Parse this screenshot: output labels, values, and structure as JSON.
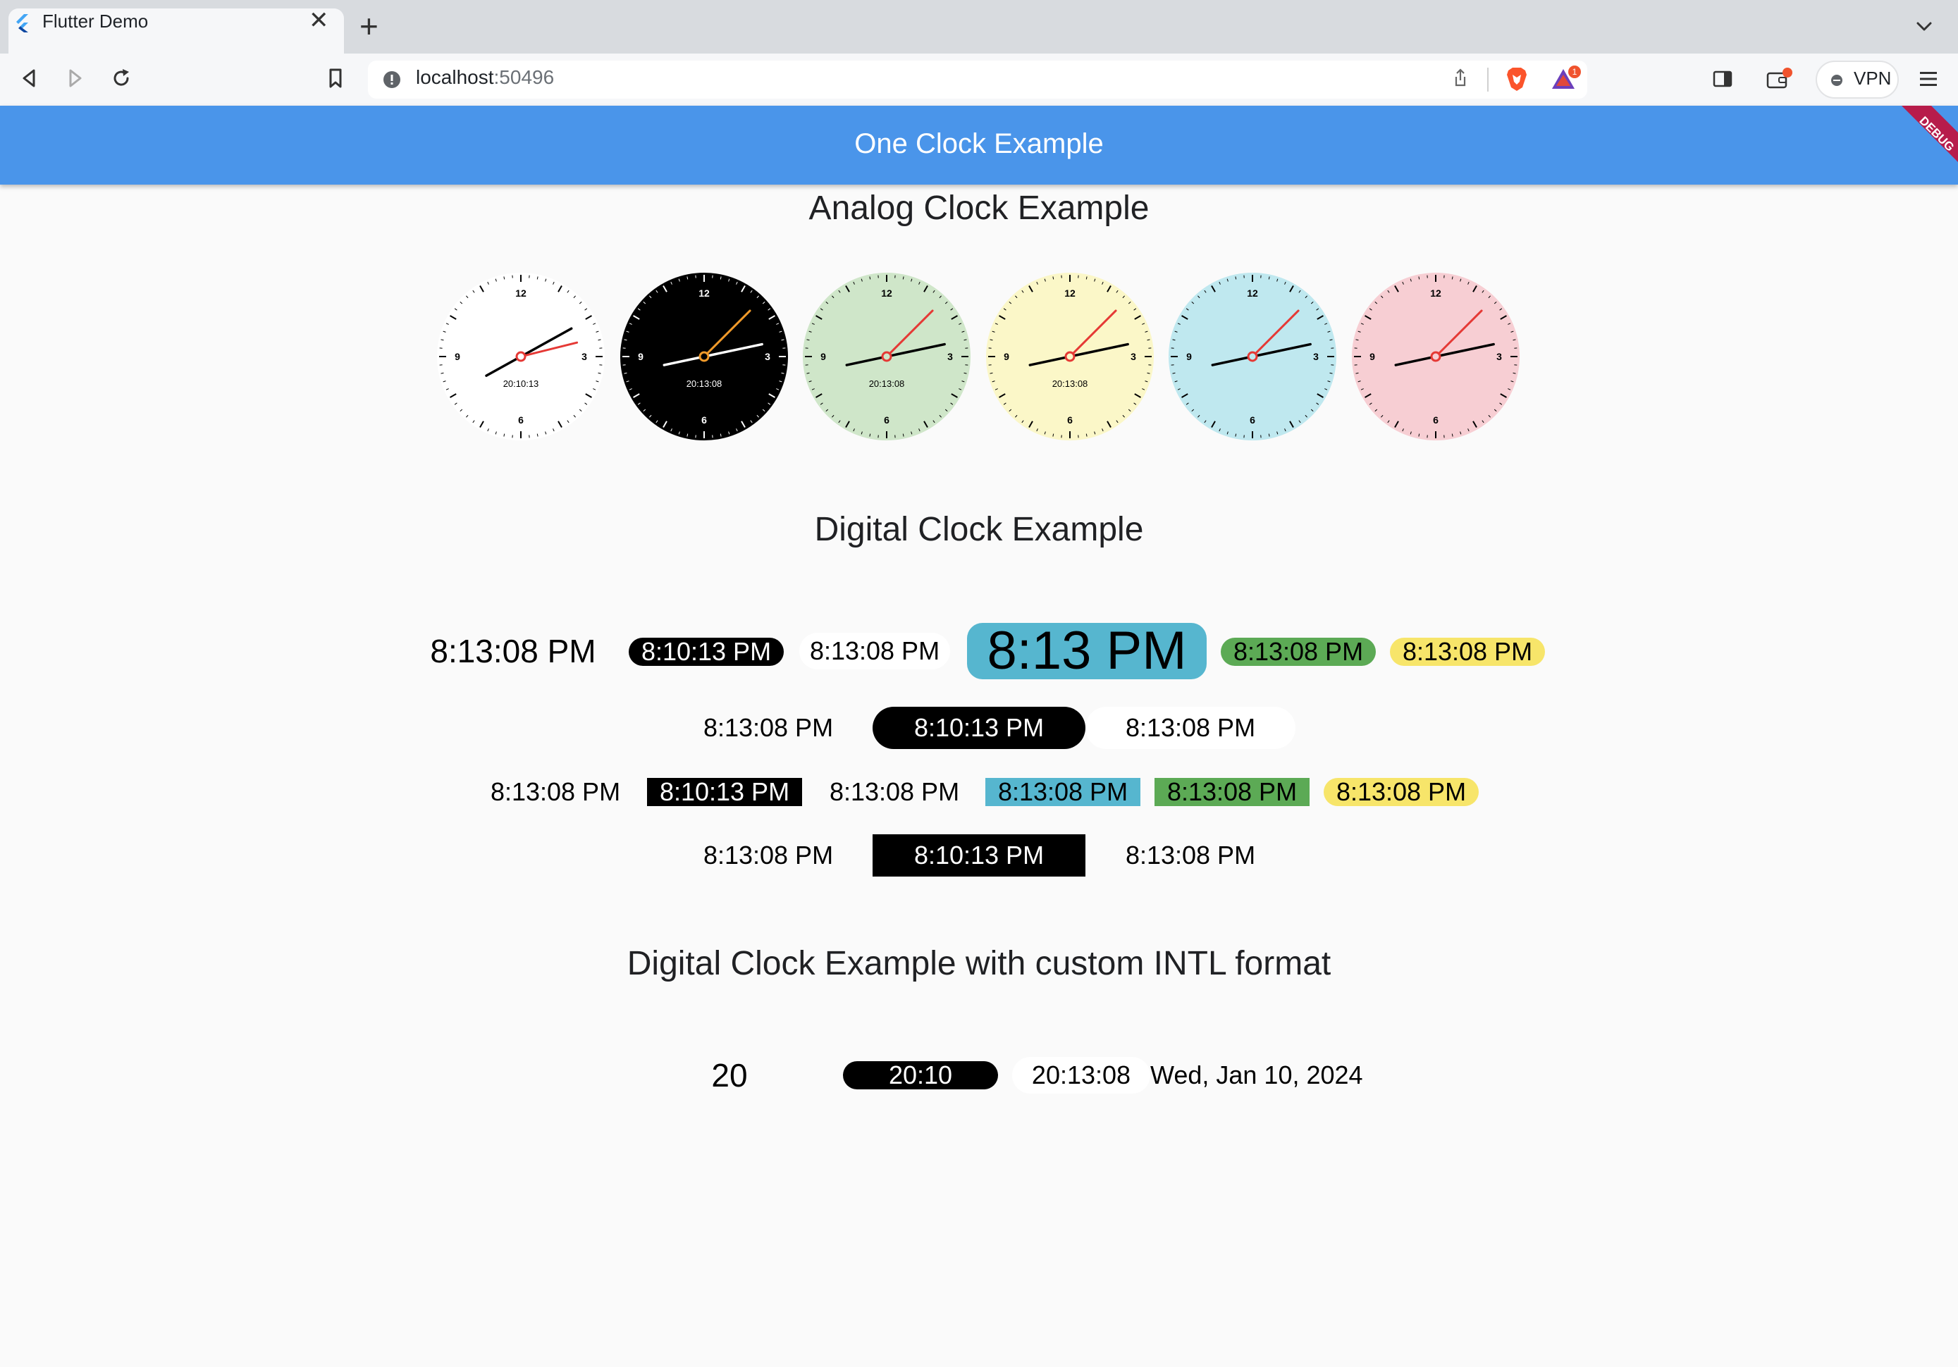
{
  "browser": {
    "tab_title": "Flutter Demo",
    "close_glyph": "✕",
    "new_tab_glyph": "+",
    "url_host": "localhost",
    "url_port": ":50496",
    "rewards_badge": "1",
    "vpn_label": "VPN"
  },
  "app": {
    "title": "One Clock Example",
    "debug_label": "DEBUG"
  },
  "sections": {
    "analog_title": "Analog Clock Example",
    "digital_title": "Digital Clock Example",
    "intl_title": "Digital Clock Example with custom INTL format"
  },
  "analog_clocks": [
    {
      "face": "#ffffff",
      "ring": "none",
      "numbers": [
        "12",
        "3",
        "6",
        "9"
      ],
      "time_text": "20:10:13",
      "hour_hand": "#000000",
      "minute_hand": "#000000",
      "second_hand": "#e53935",
      "ticks": "#000000"
    },
    {
      "face": "#000000",
      "ring": "#000000",
      "numbers": [
        "12",
        "3",
        "6",
        "9"
      ],
      "time_text": "20:13:08",
      "hour_hand": "#ffffff",
      "minute_hand": "#ffffff",
      "second_hand": "#f09a2a",
      "ticks": "#ffffff"
    },
    {
      "face": "#cfe6c9",
      "ring": "none",
      "numbers": [
        "12",
        "3",
        "6",
        "9"
      ],
      "time_text": "20:13:08",
      "hour_hand": "#000000",
      "minute_hand": "#000000",
      "second_hand": "#e53935",
      "ticks": "#000000"
    },
    {
      "face": "#fbf7c8",
      "ring": "none",
      "numbers": [
        "12",
        "3",
        "6",
        "9"
      ],
      "time_text": "20:13:08",
      "hour_hand": "#000000",
      "minute_hand": "#000000",
      "second_hand": "#e53935",
      "ticks": "#000000"
    },
    {
      "face": "#bfe8ef",
      "ring": "none",
      "numbers": [
        "12",
        "3",
        "6",
        "9"
      ],
      "time_text": "",
      "hour_hand": "#000000",
      "minute_hand": "#000000",
      "second_hand": "#e53935",
      "ticks": "#000000"
    },
    {
      "face": "#f7ced3",
      "ring": "none",
      "numbers": [
        "12",
        "3",
        "6",
        "9"
      ],
      "time_text": "",
      "hour_hand": "#000000",
      "minute_hand": "#000000",
      "second_hand": "#e53935",
      "ticks": "#000000"
    }
  ],
  "digital_rows": [
    [
      "8:13:08 PM",
      "8:10:13 PM",
      "8:13:08 PM",
      "8:13 PM",
      "8:13:08 PM",
      "8:13:08 PM"
    ],
    [
      "8:13:08 PM",
      "8:10:13 PM",
      "8:13:08 PM"
    ],
    [
      "8:13:08 PM",
      "8:10:13 PM",
      "8:13:08 PM",
      "8:13:08 PM",
      "8:13:08 PM",
      "8:13:08 PM"
    ],
    [
      "8:13:08 PM",
      "8:10:13 PM",
      "8:13:08 PM"
    ]
  ],
  "intl_row": [
    "20",
    "20:10",
    "20:13:08",
    "Wed, Jan 10, 2024"
  ],
  "colors": {
    "appbar": "#4a95ea",
    "debug_banner": "#b71c4b",
    "clock_blue": "#56b6cf",
    "clock_green": "#5caa55",
    "clock_yellow": "#f7e56a"
  }
}
